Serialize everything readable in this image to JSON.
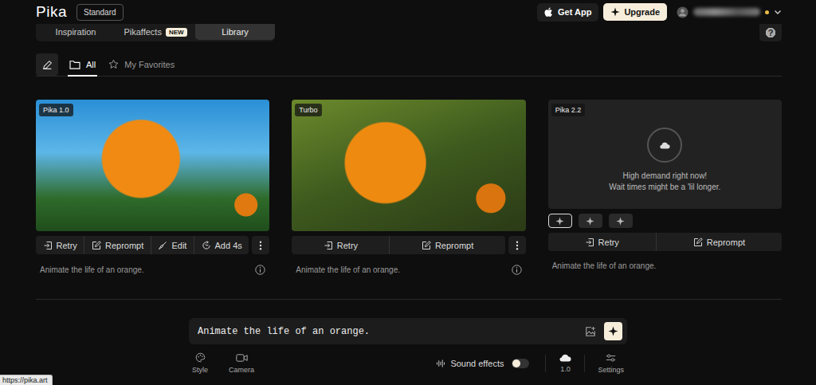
{
  "header": {
    "logo": "Pika",
    "plan": "Standard",
    "get_app": "Get App",
    "upgrade": "Upgrade",
    "account": {
      "indicator": true
    }
  },
  "nav_tabs": [
    {
      "label": "Inspiration",
      "selected": false,
      "badge": ""
    },
    {
      "label": "Pikaffects",
      "selected": false,
      "badge": "NEW"
    },
    {
      "label": "Library",
      "selected": true,
      "badge": ""
    }
  ],
  "help_icon": "?",
  "filters": [
    {
      "label": "All",
      "selected": true,
      "kind": "folder"
    },
    {
      "label": "My Favorites",
      "selected": false,
      "kind": "star"
    }
  ],
  "cards": [
    {
      "model": "Pika 1.0",
      "kind": "video",
      "status_lines": [],
      "variants": [],
      "actions": [
        {
          "label": "Retry",
          "kind": "retry"
        },
        {
          "label": "Reprompt",
          "kind": "reprompt"
        },
        {
          "label": "Edit",
          "kind": "edit"
        },
        {
          "label": "Add 4s",
          "kind": "extend"
        }
      ],
      "more": true,
      "prompt": "Animate the life of an orange.",
      "info": true
    },
    {
      "model": "Turbo",
      "kind": "video",
      "status_lines": [],
      "variants": [],
      "actions": [
        {
          "label": "Retry",
          "kind": "retry"
        },
        {
          "label": "Reprompt",
          "kind": "reprompt"
        }
      ],
      "more": true,
      "prompt": "Animate the life of an orange.",
      "info": true
    },
    {
      "model": "Pika 2.2",
      "kind": "pending",
      "status_lines": [
        "High demand right now!",
        "Wait times might be a 'lil longer."
      ],
      "variants": [
        {
          "selected": true
        },
        {
          "selected": false
        },
        {
          "selected": false
        }
      ],
      "actions": [
        {
          "label": "Retry",
          "kind": "retry"
        },
        {
          "label": "Reprompt",
          "kind": "reprompt"
        }
      ],
      "more": false,
      "prompt": "Animate the life of an orange.",
      "info": false
    }
  ],
  "prompt_bar": {
    "value": "Animate the life of an orange."
  },
  "toolbar": {
    "left": [
      {
        "label": "Style",
        "kind": "style"
      },
      {
        "label": "Camera",
        "kind": "camera"
      }
    ],
    "sound_effects": {
      "label": "Sound effects",
      "on": false
    },
    "model": {
      "label": "1.0"
    },
    "settings": {
      "label": "Settings"
    }
  },
  "status_url": "https://pika.art"
}
